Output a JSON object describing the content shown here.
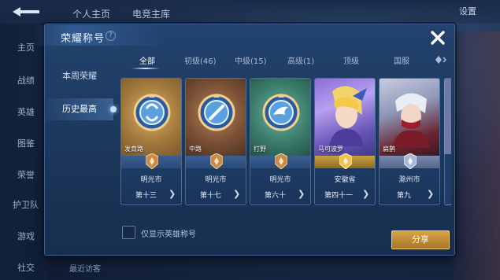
{
  "background": {
    "tabs": [
      "个人主页",
      "电竞主库"
    ],
    "top_right": "设置",
    "top_right_small": "",
    "side_items": [
      "主页",
      "战绩",
      "英雄",
      "图鉴",
      "荣誉",
      "护卫队",
      "游戏",
      "社交"
    ],
    "bottom_text": "最近访客"
  },
  "modal": {
    "title": "荣耀称号",
    "help_icon": "?",
    "close_icon": "close-icon",
    "left_menu": [
      {
        "label": "本周荣耀",
        "active": false
      },
      {
        "label": "历史最高",
        "active": true
      }
    ],
    "filters": [
      {
        "label": "全部",
        "active": true
      },
      {
        "label": "初级(46)",
        "active": false
      },
      {
        "label": "中级(15)",
        "active": false
      },
      {
        "label": "高级(1)",
        "active": false
      },
      {
        "label": "顶级",
        "active": false
      },
      {
        "label": "国服",
        "active": false
      }
    ],
    "filter_more_icon": "diamond-arrow-icon",
    "cards": [
      {
        "lane": "发育路",
        "region": "明光市",
        "rank": "第十三",
        "kind": "lane",
        "theme": "gold",
        "badge": "bronze"
      },
      {
        "lane": "中路",
        "region": "明光市",
        "rank": "第十七",
        "kind": "lane",
        "theme": "brown",
        "badge": "bronze"
      },
      {
        "lane": "打野",
        "region": "明光市",
        "rank": "第六十",
        "kind": "lane",
        "theme": "teal",
        "badge": "bronze"
      },
      {
        "lane": "马可波罗",
        "region": "安徽省",
        "rank": "第四十一",
        "kind": "hero",
        "theme": "hero1",
        "badge": "gold"
      },
      {
        "lane": "扁鹊",
        "region": "滁州市",
        "rank": "第九",
        "kind": "hero",
        "theme": "hero2",
        "badge": "silver"
      }
    ],
    "checkbox_label": "仅显示英雄称号",
    "share_label": "分享"
  },
  "colors": {
    "accent_gold": "#d6a447",
    "panel": "#1b3659",
    "bronze": "#c98a4a",
    "silver": "#aab8d4",
    "gold": "#f0c14b"
  }
}
